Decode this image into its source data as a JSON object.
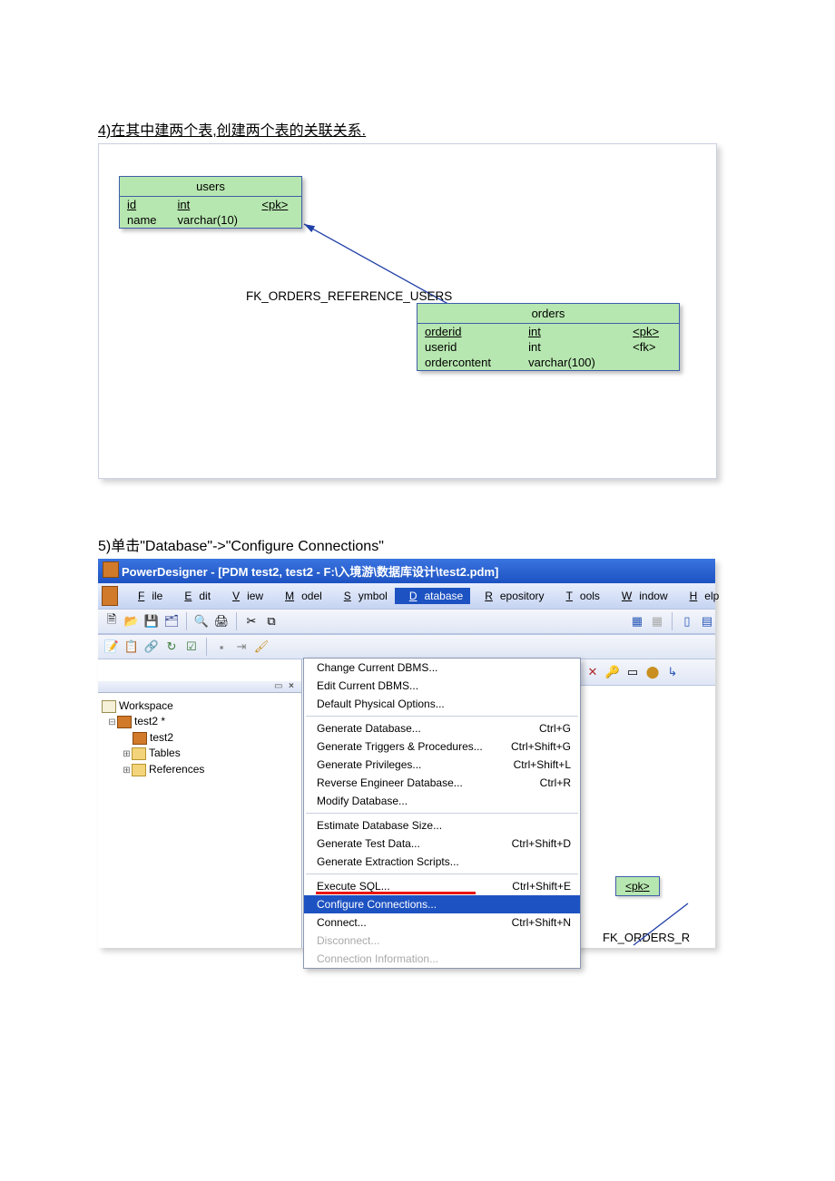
{
  "step4": "4)在其中建两个表,创建两个表的关联关系.",
  "step5": "5)单击\"Database\"->\"Configure Connections\"",
  "users": {
    "title": "users",
    "cols": [
      {
        "name": "id",
        "type": "int",
        "key": "<pk>",
        "u": true
      },
      {
        "name": "name",
        "type": "varchar(10)",
        "key": "",
        "u": false
      }
    ]
  },
  "orders": {
    "title": "orders",
    "cols": [
      {
        "name": "orderid",
        "type": "int",
        "key": "<pk>",
        "u": true
      },
      {
        "name": "userid",
        "type": "int",
        "key": "<fk>",
        "u": false
      },
      {
        "name": "ordercontent",
        "type": "varchar(100)",
        "key": "",
        "u": false
      }
    ]
  },
  "relLabel": "FK_ORDERS_REFERENCE_USERS",
  "pd": {
    "title": "PowerDesigner - [PDM test2, test2 - F:\\入境游\\数据库设计\\test2.pdm]",
    "menu": [
      "File",
      "Edit",
      "View",
      "Model",
      "Symbol",
      "Database",
      "Repository",
      "Tools",
      "Window",
      "Help"
    ],
    "tree": {
      "ws": "Workspace",
      "model": "test2 *",
      "pdm": "test2",
      "tables": "Tables",
      "refs": "References"
    },
    "dd": [
      {
        "t": "Change Current DBMS...",
        "k": "",
        "type": "i"
      },
      {
        "t": "Edit Current DBMS...",
        "k": "",
        "type": "i"
      },
      {
        "t": "Default Physical Options...",
        "k": "",
        "type": "i"
      },
      {
        "type": "sep"
      },
      {
        "t": "Generate Database...",
        "k": "Ctrl+G",
        "type": "i"
      },
      {
        "t": "Generate Triggers & Procedures...",
        "k": "Ctrl+Shift+G",
        "type": "i"
      },
      {
        "t": "Generate Privileges...",
        "k": "Ctrl+Shift+L",
        "type": "i"
      },
      {
        "t": "Reverse Engineer Database...",
        "k": "Ctrl+R",
        "type": "i"
      },
      {
        "t": "Modify Database...",
        "k": "",
        "type": "i"
      },
      {
        "type": "sep"
      },
      {
        "t": "Estimate Database Size...",
        "k": "",
        "type": "i"
      },
      {
        "t": "Generate Test Data...",
        "k": "Ctrl+Shift+D",
        "type": "i"
      },
      {
        "t": "Generate Extraction Scripts...",
        "k": "",
        "type": "i"
      },
      {
        "type": "sep"
      },
      {
        "t": "Execute SQL...",
        "k": "Ctrl+Shift+E",
        "type": "i"
      },
      {
        "t": "Configure Connections...",
        "k": "",
        "type": "hl"
      },
      {
        "t": "Connect...",
        "k": "Ctrl+Shift+N",
        "type": "i"
      },
      {
        "t": "Disconnect...",
        "k": "",
        "type": "dis"
      },
      {
        "t": "Connection Information...",
        "k": "",
        "type": "dis"
      }
    ],
    "peek": {
      "pk": "<pk>",
      "label": "FK_ORDERS_R"
    }
  }
}
